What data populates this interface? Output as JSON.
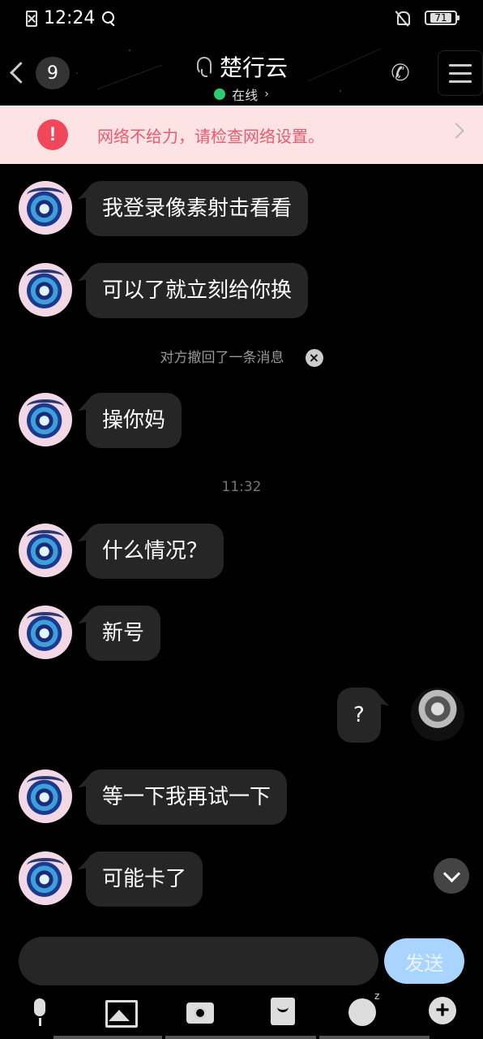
{
  "status_bar": {
    "time": "12:24",
    "battery": "71"
  },
  "header": {
    "back_count": "9",
    "title": "楚行云",
    "presence": "在线",
    "presence_chevron": "›"
  },
  "banner": {
    "alert": "!",
    "text": "网络不给力，请检查网络设置。"
  },
  "messages": [
    {
      "side": "in",
      "text": "我登录像素射击看看"
    },
    {
      "side": "in",
      "text": "可以了就立刻给你换"
    },
    {
      "side": "in",
      "text": "操你妈"
    },
    {
      "side": "in",
      "text": "什么情况？"
    },
    {
      "side": "in",
      "text": "新号"
    },
    {
      "side": "out",
      "text": "?"
    },
    {
      "side": "in",
      "text": "等一下我再试一下"
    },
    {
      "side": "in",
      "text": "可能卡了"
    }
  ],
  "recall_notice": "对方撤回了一条消息",
  "recall_close": "×",
  "timestamp": "11:32",
  "input": {
    "placeholder": "",
    "value": "",
    "send_label": "发送"
  }
}
